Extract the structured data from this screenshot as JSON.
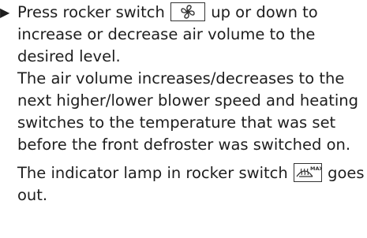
{
  "instructions": {
    "step_bullet": "▶",
    "step_text_before_icon": "Press rocker switch",
    "step_icon": "fan-icon",
    "step_text_after_icon": "up or down to increase or decrease air volume to the desired level.",
    "result_paragraph": "The air volume increases/decreases to the next higher/lower blower speed and heating switches to the temperature that was set before the front defroster was switched on.",
    "lamp_text_before_icon": "The indicator lamp in rocker switch",
    "lamp_icon": "defroster-max-icon",
    "lamp_icon_label": "MAX",
    "lamp_text_after_icon": "goes out."
  }
}
